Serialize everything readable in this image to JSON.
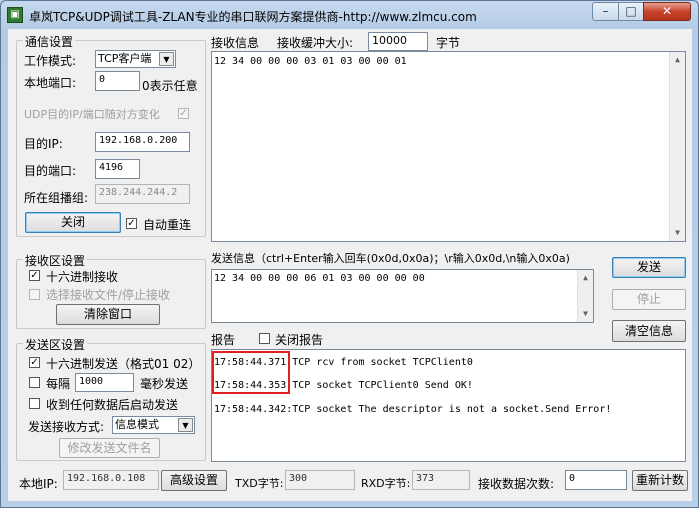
{
  "window": {
    "title": "卓岚TCP&UDP调试工具-ZLAN专业的串口联网方案提供商-http://www.zlmcu.com",
    "min_label": "–",
    "max_label": "□",
    "close_label": "✕"
  },
  "comm": {
    "title": "通信设置",
    "mode_label": "工作模式:",
    "mode_value": "TCP客户端",
    "local_port_label": "本地端口:",
    "local_port_value": "0",
    "local_port_hint": "0表示任意",
    "udp_random_label": "UDP目的IP/端口随对方变化",
    "dest_ip_label": "目的IP:",
    "dest_ip_value": "192.168.0.200",
    "dest_port_label": "目的端口:",
    "dest_port_value": "4196",
    "multicast_label": "所在组播组:",
    "multicast_value": "238.244.244.2",
    "close_button": "关闭",
    "auto_reconnect_label": "自动重连"
  },
  "recv": {
    "info_label": "接收信息",
    "buffer_label": "接收缓冲大小:",
    "buffer_value": "10000",
    "buffer_unit": "字节",
    "content": "12 34 00 00 00 03 01 03 00 00 01"
  },
  "recv_settings": {
    "title": "接收区设置",
    "hex_label": "十六进制接收",
    "file_label": "选择接收文件/停止接收",
    "clear_button": "清除窗口"
  },
  "send": {
    "info_label": "发送信息（ctrl+Enter输入回车(0x0d,0x0a)；\\r输入0x0d,\\n输入0x0a)",
    "content": "12 34 00 00 00 06 01 03 00 00 00 00",
    "send_button": "发送",
    "stop_button": "停止",
    "clear_info_button": "清空信息"
  },
  "send_settings": {
    "title": "发送区设置",
    "hex_label": "十六进制发送（格式01 02）",
    "interval_label": "每隔",
    "interval_value": "1000",
    "interval_unit": "毫秒发送",
    "auto_send_label": "收到任何数据后启动发送",
    "method_label": "发送接收方式:",
    "method_value": "信息模式",
    "edit_file_button": "修改发送文件名"
  },
  "report": {
    "label": "报告",
    "close_report_label": "关闭报告",
    "lines": [
      {
        "time": "17:58:44.371",
        "text": ":TCP rcv from socket TCPClient0"
      },
      {
        "time": "17:58:44.353",
        "text": ":TCP socket TCPClient0  Send OK!"
      },
      {
        "time": "17:58:44.342",
        "text": ":TCP socket  The descriptor is not a socket.Send Error!"
      }
    ]
  },
  "status": {
    "local_ip_label": "本地IP:",
    "local_ip_value": "192.168.0.108",
    "advanced_button": "高级设置",
    "txd_label": "TXD字节:",
    "txd_value": "300",
    "rxd_label": "RXD字节:",
    "rxd_value": "373",
    "recv_count_label": "接收数据次数:",
    "recv_count_value": "0",
    "reset_button": "重新计数"
  },
  "colors": {
    "highlight": "#e02020"
  }
}
